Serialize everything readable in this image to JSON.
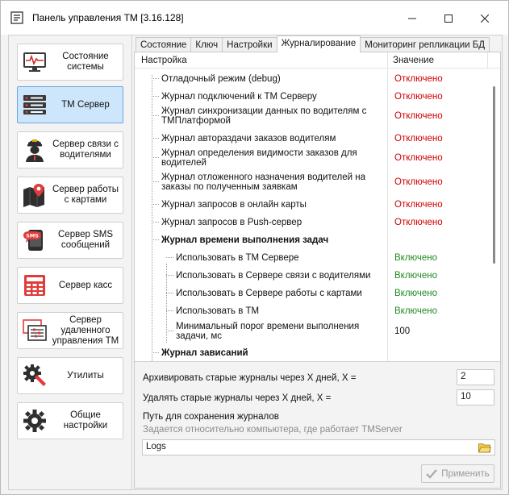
{
  "window": {
    "title": "Панель управления ТМ [3.16.128]",
    "controls": [
      "minimize",
      "maximize",
      "close"
    ]
  },
  "sidebar": {
    "items": [
      {
        "label": "Состояние системы",
        "icon": "system-status-icon",
        "active": false
      },
      {
        "label": "ТМ Сервер",
        "icon": "server-icon",
        "active": true
      },
      {
        "label": "Сервер связи с водителями",
        "icon": "driver-icon",
        "active": false
      },
      {
        "label": "Сервер работы с картами",
        "icon": "map-icon",
        "active": false
      },
      {
        "label": "Сервер SMS сообщений",
        "icon": "sms-icon",
        "active": false
      },
      {
        "label": "Сервер касс",
        "icon": "cash-register-icon",
        "active": false
      },
      {
        "label": "Сервер удаленного управления ТМ",
        "icon": "remote-control-icon",
        "active": false
      },
      {
        "label": "Утилиты",
        "icon": "utilities-icon",
        "active": false
      },
      {
        "label": "Общие настройки",
        "icon": "gear-icon",
        "active": false
      }
    ]
  },
  "tabs": [
    "Состояние",
    "Ключ",
    "Настройки",
    "Журналирование",
    "Мониторинг репликации БД"
  ],
  "active_tab": "Журналирование",
  "grid": {
    "col_setting": "Настройка",
    "col_value": "Значение",
    "rows": [
      {
        "name": "Отладочный режим (debug)",
        "value": "Отключено",
        "state": "off"
      },
      {
        "name": "Журнал подключений к ТМ Серверу",
        "value": "Отключено",
        "state": "off"
      },
      {
        "name": "Журнал синхронизации данных по водителям с ТМПлатформой",
        "value": "Отключено",
        "state": "off"
      },
      {
        "name": "Журнал автораздачи заказов водителям",
        "value": "Отключено",
        "state": "off"
      },
      {
        "name": "Журнал определения видимости заказов для водителей",
        "value": "Отключено",
        "state": "off"
      },
      {
        "name": "Журнал отложенного назначения водителей на заказы по полученным заявкам",
        "value": "Отключено",
        "state": "off"
      },
      {
        "name": "Журнал запросов в онлайн карты",
        "value": "Отключено",
        "state": "off"
      },
      {
        "name": "Журнал запросов в Push-сервер",
        "value": "Отключено",
        "state": "off"
      },
      {
        "name": "Журнал времени выполнения задач",
        "value": "",
        "state": "group"
      },
      {
        "name": "Использовать в ТМ Сервере",
        "value": "Включено",
        "state": "on"
      },
      {
        "name": "Использовать в Сервере связи с водителями",
        "value": "Включено",
        "state": "on"
      },
      {
        "name": "Использовать в Сервере работы с картами",
        "value": "Включено",
        "state": "on"
      },
      {
        "name": "Использовать в ТМ",
        "value": "Включено",
        "state": "on"
      },
      {
        "name": "Минимальный порог времени выполнения задачи, мс",
        "value": "100",
        "state": "num"
      },
      {
        "name": "Журнал зависаний",
        "value": "",
        "state": "group"
      }
    ]
  },
  "archive": {
    "label": "Архивировать старые журналы через X дней, X =",
    "value": "2"
  },
  "delete": {
    "label": "Удалять старые журналы через X дней, X =",
    "value": "10"
  },
  "path": {
    "label": "Путь для сохранения журналов",
    "hint": "Задается относительно компьютера, где работает TMServer",
    "value": "Logs"
  },
  "apply_label": "Применить",
  "colors": {
    "off": "#d10000",
    "on": "#1f8a1f",
    "active_sidebar": "#cde6fb"
  }
}
